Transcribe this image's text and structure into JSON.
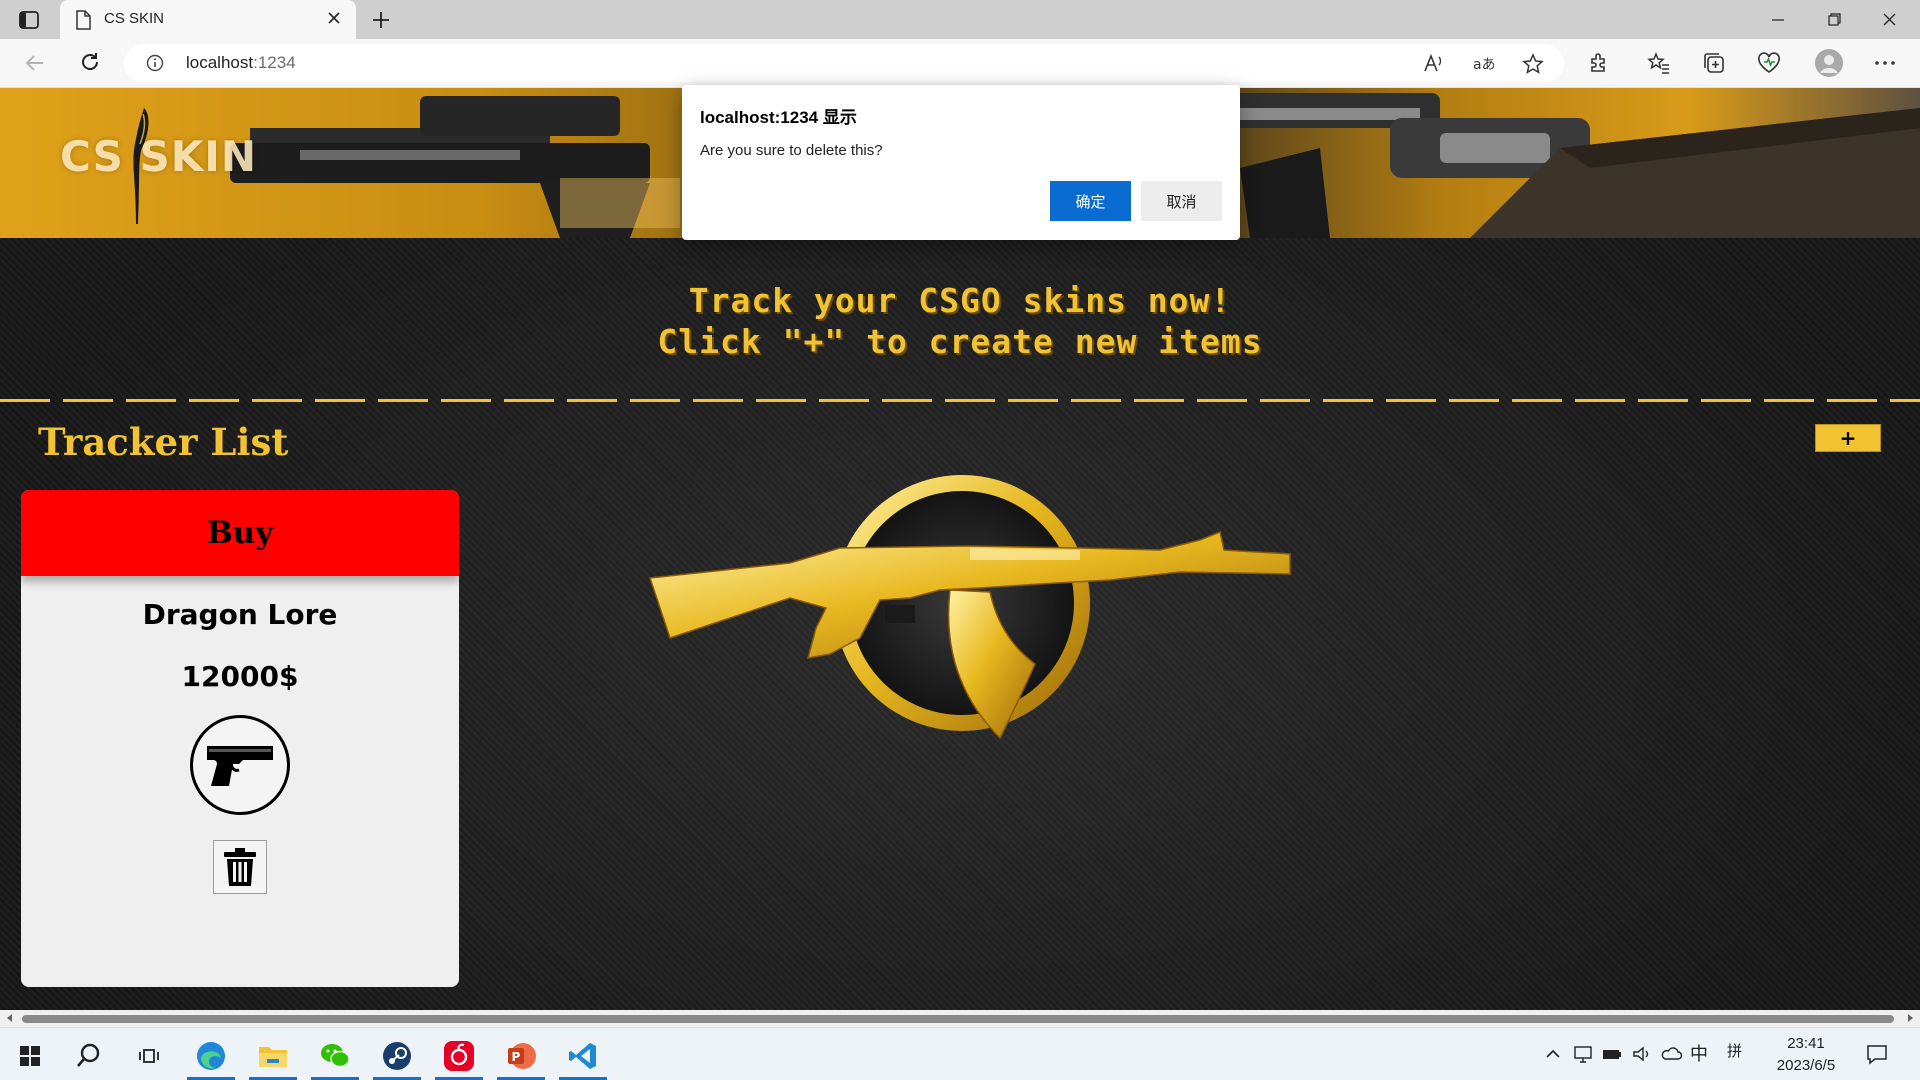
{
  "browser": {
    "tab_title": "CS SKIN",
    "url_host": "localhost",
    "url_port": ":1234"
  },
  "page": {
    "brand": "CS SKIN",
    "tagline_line1": "Track your CSGO skins now!",
    "tagline_line2": "Click \"+\" to create new items",
    "list_title": "Tracker List",
    "add_button_label": "+",
    "card": {
      "status": "Buy",
      "item_name": "Dragon Lore",
      "price": "12000$"
    }
  },
  "dialog": {
    "title": "localhost:1234 显示",
    "message": "Are you sure to delete this?",
    "ok_label": "确定",
    "cancel_label": "取消"
  },
  "taskbar": {
    "lang": "中",
    "ime": "拼",
    "time": "23:41",
    "date": "2023/6/5"
  },
  "colors": {
    "accent_gold": "#f1c232",
    "status_buy": "#ff0000",
    "dialog_primary": "#0a6cd1"
  },
  "icons": [
    "sidebar-toggle-icon",
    "page-icon",
    "close-icon",
    "plus-icon",
    "back-icon",
    "refresh-icon",
    "info-icon",
    "read-aloud-icon",
    "translate-icon",
    "star-icon",
    "extensions-icon",
    "favorites-icon",
    "collections-icon",
    "browser-essentials-icon",
    "profile-icon",
    "more-icon",
    "pistol-icon",
    "trash-icon",
    "windows-icon",
    "search-icon",
    "task-view-icon",
    "edge-icon",
    "file-explorer-icon",
    "wechat-icon",
    "steam-icon",
    "netease-music-icon",
    "powerpoint-icon",
    "vscode-icon"
  ]
}
